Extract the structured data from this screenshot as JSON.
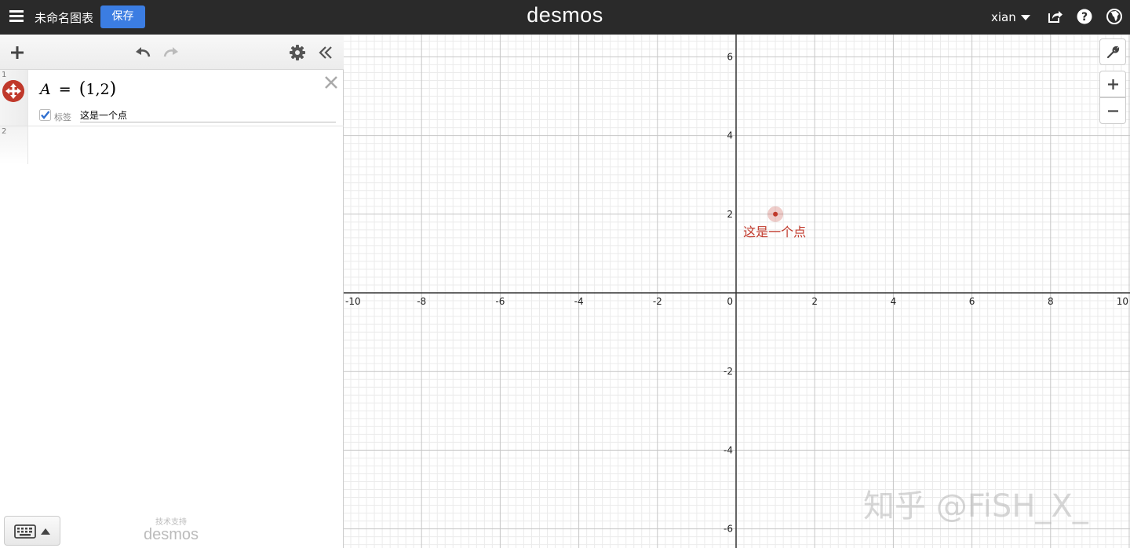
{
  "header": {
    "menu_icon": "hamburger-icon",
    "title": "未命名图表",
    "save_label": "保存",
    "logo": "desmos",
    "user": "xian",
    "icons": [
      "share-icon",
      "help-icon",
      "language-globe-icon"
    ]
  },
  "sidebar": {
    "toolbar_icons": [
      "add-icon",
      "undo-icon",
      "redo-icon",
      "gear-icon",
      "collapse-icon"
    ],
    "expressions": [
      {
        "number": "1",
        "var": "A",
        "eq": "=",
        "open": "(",
        "x": "1",
        "comma": ",",
        "y": "2",
        "close": ")",
        "label_checkbox_text": "标签",
        "label_value": "这是一个点",
        "color": "#c0392b"
      },
      {
        "number": "2"
      }
    ],
    "powered_by_small": "技术支持",
    "powered_by_logo": "desmos"
  },
  "graph": {
    "x_ticks": [
      "-10",
      "-8",
      "-6",
      "-4",
      "-2",
      "0",
      "2",
      "4",
      "6",
      "8",
      "10"
    ],
    "y_ticks": [
      "6",
      "4",
      "2",
      "-2",
      "-4",
      "-6"
    ],
    "points": [
      {
        "x": 1,
        "y": 2,
        "label": "这是一个点",
        "color": "#c0392b"
      }
    ],
    "buttons": [
      "wrench-icon",
      "zoom-in-icon",
      "zoom-out-icon"
    ]
  },
  "watermark": "知乎 @FiSH_X_"
}
